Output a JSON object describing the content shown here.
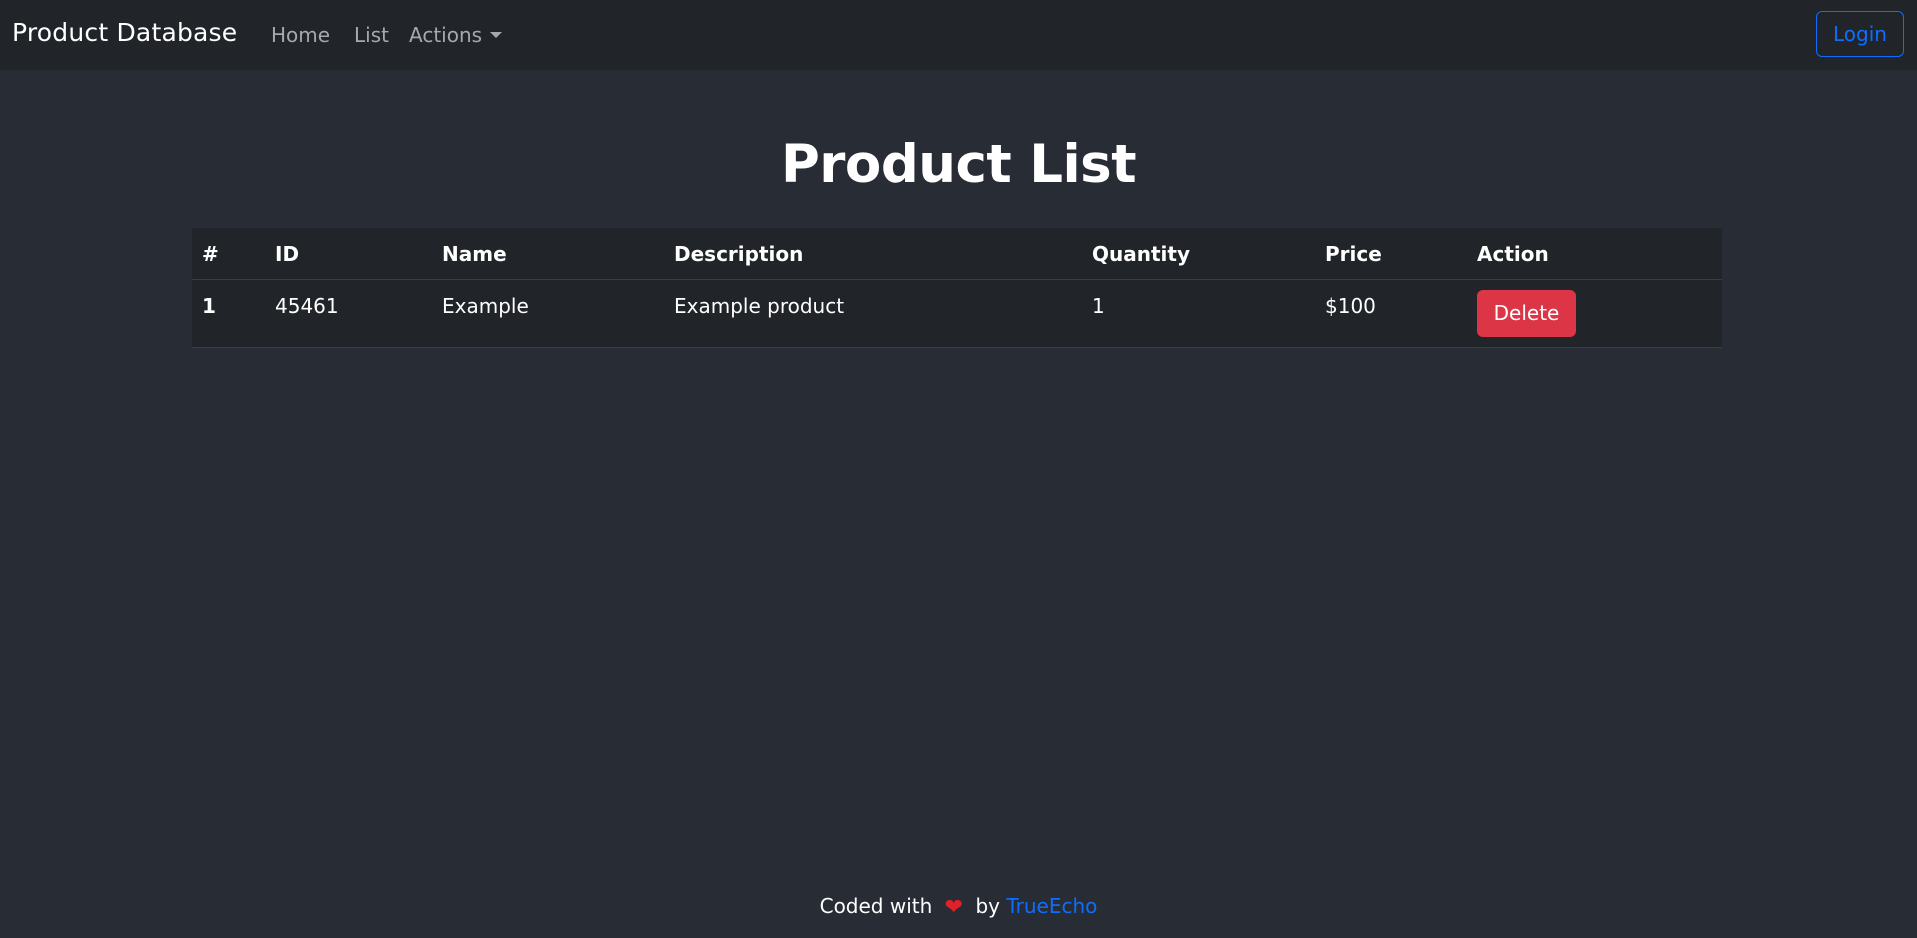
{
  "navbar": {
    "brand": "Product Database",
    "links": [
      {
        "label": "Home"
      },
      {
        "label": "List"
      },
      {
        "label": "Actions"
      }
    ],
    "login_label": "Login"
  },
  "main": {
    "title": "Product List",
    "table": {
      "columns": [
        "#",
        "ID",
        "Name",
        "Description",
        "Quantity",
        "Price",
        "Action"
      ],
      "rows": [
        {
          "num": "1",
          "id": "45461",
          "name": "Example",
          "description": "Example product",
          "quantity": "1",
          "price": "$100",
          "action_label": "Delete"
        }
      ]
    }
  },
  "footer": {
    "prefix": "Coded with",
    "icon": "heart-icon",
    "by": "by",
    "author": "TrueEcho"
  },
  "colors": {
    "background": "#282c35",
    "navbar": "#212429",
    "accent": "#0d6efd",
    "danger": "#dc3545",
    "heart": "#e0202a"
  }
}
